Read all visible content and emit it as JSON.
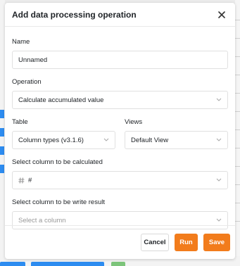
{
  "dialog": {
    "title": "Add data processing operation",
    "close_icon": "close-icon"
  },
  "form": {
    "name": {
      "label": "Name",
      "value": "Unnamed"
    },
    "operation": {
      "label": "Operation",
      "value": "Calculate accumulated value"
    },
    "table": {
      "label": "Table",
      "value": "Column types (v3.1.6)"
    },
    "views": {
      "label": "Views",
      "value": "Default View"
    },
    "calc_column": {
      "label": "Select column to be calculated",
      "value": "#",
      "icon": "number-column-icon"
    },
    "result_column": {
      "label": "Select column to be write result",
      "placeholder": "Select a column"
    }
  },
  "footer": {
    "cancel_label": "Cancel",
    "run_label": "Run",
    "save_label": "Save"
  },
  "colors": {
    "primary": "#f27c1c",
    "border": "#e0e0e0",
    "text": "#212529"
  }
}
